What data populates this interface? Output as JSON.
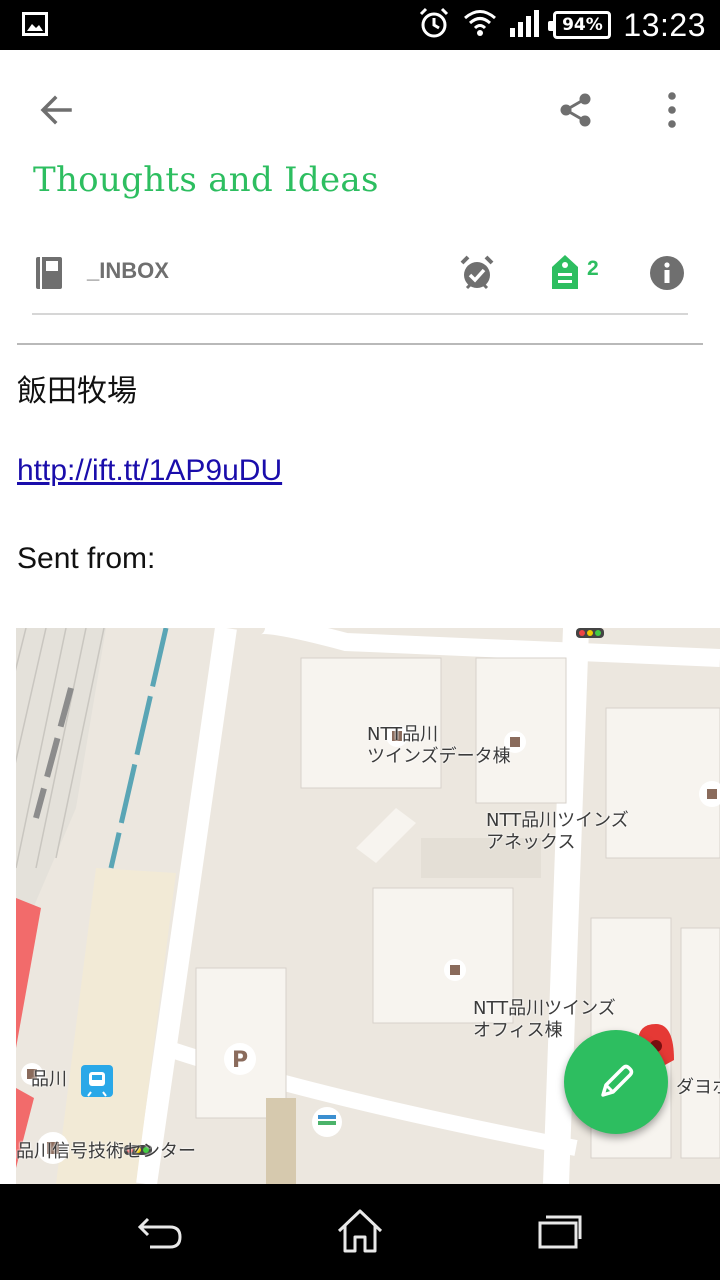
{
  "status_bar": {
    "battery": "94%",
    "time": "13:23",
    "icons": [
      "image-icon",
      "alarm-icon",
      "wifi-icon",
      "signal-icon",
      "battery-icon"
    ]
  },
  "toolbar": {
    "back_icon": "arrow-back-icon",
    "share_icon": "share-icon",
    "overflow_icon": "more-vert-icon"
  },
  "note": {
    "title": "Thoughts and Ideas",
    "notebook": "_INBOX",
    "tag_count": "2",
    "lines": {
      "heading": "飯田牧場",
      "link": "http://ift.tt/1AP9uDU",
      "sent_from": "Sent from:"
    }
  },
  "map": {
    "labels": {
      "l1": "NTT品川\nツインズデータ棟",
      "l2": "NTT品川ツインズ\nアネックス",
      "l3": "NTT品川ツインズ\nオフィス棟",
      "l4": "品川",
      "l5": "品川信号技術センター",
      "l6": "ダヨホ"
    }
  },
  "colors": {
    "accent": "#2DBE60",
    "icon_gray": "#6f6f6f",
    "link": "#1a0dab"
  },
  "fab": {
    "icon": "pencil-icon"
  },
  "nav": {
    "back_icon": "nav-back-icon",
    "home_icon": "nav-home-icon",
    "recents_icon": "nav-recents-icon"
  }
}
